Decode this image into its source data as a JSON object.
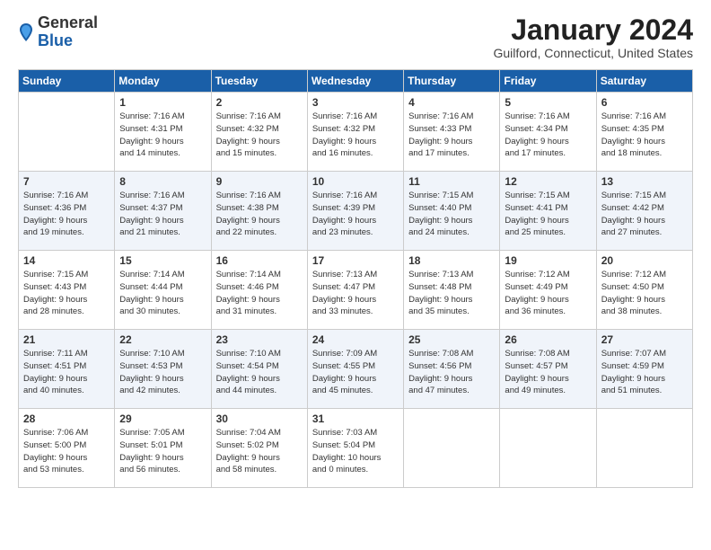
{
  "header": {
    "logo_general": "General",
    "logo_blue": "Blue",
    "month_title": "January 2024",
    "location": "Guilford, Connecticut, United States"
  },
  "days_of_week": [
    "Sunday",
    "Monday",
    "Tuesday",
    "Wednesday",
    "Thursday",
    "Friday",
    "Saturday"
  ],
  "weeks": [
    [
      {
        "day": "",
        "sunrise": "",
        "sunset": "",
        "daylight": "",
        "empty": true
      },
      {
        "day": "1",
        "sunrise": "Sunrise: 7:16 AM",
        "sunset": "Sunset: 4:31 PM",
        "daylight": "Daylight: 9 hours and 14 minutes."
      },
      {
        "day": "2",
        "sunrise": "Sunrise: 7:16 AM",
        "sunset": "Sunset: 4:32 PM",
        "daylight": "Daylight: 9 hours and 15 minutes."
      },
      {
        "day": "3",
        "sunrise": "Sunrise: 7:16 AM",
        "sunset": "Sunset: 4:32 PM",
        "daylight": "Daylight: 9 hours and 16 minutes."
      },
      {
        "day": "4",
        "sunrise": "Sunrise: 7:16 AM",
        "sunset": "Sunset: 4:33 PM",
        "daylight": "Daylight: 9 hours and 17 minutes."
      },
      {
        "day": "5",
        "sunrise": "Sunrise: 7:16 AM",
        "sunset": "Sunset: 4:34 PM",
        "daylight": "Daylight: 9 hours and 17 minutes."
      },
      {
        "day": "6",
        "sunrise": "Sunrise: 7:16 AM",
        "sunset": "Sunset: 4:35 PM",
        "daylight": "Daylight: 9 hours and 18 minutes."
      }
    ],
    [
      {
        "day": "7",
        "sunrise": "Sunrise: 7:16 AM",
        "sunset": "Sunset: 4:36 PM",
        "daylight": "Daylight: 9 hours and 19 minutes."
      },
      {
        "day": "8",
        "sunrise": "Sunrise: 7:16 AM",
        "sunset": "Sunset: 4:37 PM",
        "daylight": "Daylight: 9 hours and 21 minutes."
      },
      {
        "day": "9",
        "sunrise": "Sunrise: 7:16 AM",
        "sunset": "Sunset: 4:38 PM",
        "daylight": "Daylight: 9 hours and 22 minutes."
      },
      {
        "day": "10",
        "sunrise": "Sunrise: 7:16 AM",
        "sunset": "Sunset: 4:39 PM",
        "daylight": "Daylight: 9 hours and 23 minutes."
      },
      {
        "day": "11",
        "sunrise": "Sunrise: 7:15 AM",
        "sunset": "Sunset: 4:40 PM",
        "daylight": "Daylight: 9 hours and 24 minutes."
      },
      {
        "day": "12",
        "sunrise": "Sunrise: 7:15 AM",
        "sunset": "Sunset: 4:41 PM",
        "daylight": "Daylight: 9 hours and 25 minutes."
      },
      {
        "day": "13",
        "sunrise": "Sunrise: 7:15 AM",
        "sunset": "Sunset: 4:42 PM",
        "daylight": "Daylight: 9 hours and 27 minutes."
      }
    ],
    [
      {
        "day": "14",
        "sunrise": "Sunrise: 7:15 AM",
        "sunset": "Sunset: 4:43 PM",
        "daylight": "Daylight: 9 hours and 28 minutes."
      },
      {
        "day": "15",
        "sunrise": "Sunrise: 7:14 AM",
        "sunset": "Sunset: 4:44 PM",
        "daylight": "Daylight: 9 hours and 30 minutes."
      },
      {
        "day": "16",
        "sunrise": "Sunrise: 7:14 AM",
        "sunset": "Sunset: 4:46 PM",
        "daylight": "Daylight: 9 hours and 31 minutes."
      },
      {
        "day": "17",
        "sunrise": "Sunrise: 7:13 AM",
        "sunset": "Sunset: 4:47 PM",
        "daylight": "Daylight: 9 hours and 33 minutes."
      },
      {
        "day": "18",
        "sunrise": "Sunrise: 7:13 AM",
        "sunset": "Sunset: 4:48 PM",
        "daylight": "Daylight: 9 hours and 35 minutes."
      },
      {
        "day": "19",
        "sunrise": "Sunrise: 7:12 AM",
        "sunset": "Sunset: 4:49 PM",
        "daylight": "Daylight: 9 hours and 36 minutes."
      },
      {
        "day": "20",
        "sunrise": "Sunrise: 7:12 AM",
        "sunset": "Sunset: 4:50 PM",
        "daylight": "Daylight: 9 hours and 38 minutes."
      }
    ],
    [
      {
        "day": "21",
        "sunrise": "Sunrise: 7:11 AM",
        "sunset": "Sunset: 4:51 PM",
        "daylight": "Daylight: 9 hours and 40 minutes."
      },
      {
        "day": "22",
        "sunrise": "Sunrise: 7:10 AM",
        "sunset": "Sunset: 4:53 PM",
        "daylight": "Daylight: 9 hours and 42 minutes."
      },
      {
        "day": "23",
        "sunrise": "Sunrise: 7:10 AM",
        "sunset": "Sunset: 4:54 PM",
        "daylight": "Daylight: 9 hours and 44 minutes."
      },
      {
        "day": "24",
        "sunrise": "Sunrise: 7:09 AM",
        "sunset": "Sunset: 4:55 PM",
        "daylight": "Daylight: 9 hours and 45 minutes."
      },
      {
        "day": "25",
        "sunrise": "Sunrise: 7:08 AM",
        "sunset": "Sunset: 4:56 PM",
        "daylight": "Daylight: 9 hours and 47 minutes."
      },
      {
        "day": "26",
        "sunrise": "Sunrise: 7:08 AM",
        "sunset": "Sunset: 4:57 PM",
        "daylight": "Daylight: 9 hours and 49 minutes."
      },
      {
        "day": "27",
        "sunrise": "Sunrise: 7:07 AM",
        "sunset": "Sunset: 4:59 PM",
        "daylight": "Daylight: 9 hours and 51 minutes."
      }
    ],
    [
      {
        "day": "28",
        "sunrise": "Sunrise: 7:06 AM",
        "sunset": "Sunset: 5:00 PM",
        "daylight": "Daylight: 9 hours and 53 minutes."
      },
      {
        "day": "29",
        "sunrise": "Sunrise: 7:05 AM",
        "sunset": "Sunset: 5:01 PM",
        "daylight": "Daylight: 9 hours and 56 minutes."
      },
      {
        "day": "30",
        "sunrise": "Sunrise: 7:04 AM",
        "sunset": "Sunset: 5:02 PM",
        "daylight": "Daylight: 9 hours and 58 minutes."
      },
      {
        "day": "31",
        "sunrise": "Sunrise: 7:03 AM",
        "sunset": "Sunset: 5:04 PM",
        "daylight": "Daylight: 10 hours and 0 minutes."
      },
      {
        "day": "",
        "sunrise": "",
        "sunset": "",
        "daylight": "",
        "empty": true
      },
      {
        "day": "",
        "sunrise": "",
        "sunset": "",
        "daylight": "",
        "empty": true
      },
      {
        "day": "",
        "sunrise": "",
        "sunset": "",
        "daylight": "",
        "empty": true
      }
    ]
  ]
}
